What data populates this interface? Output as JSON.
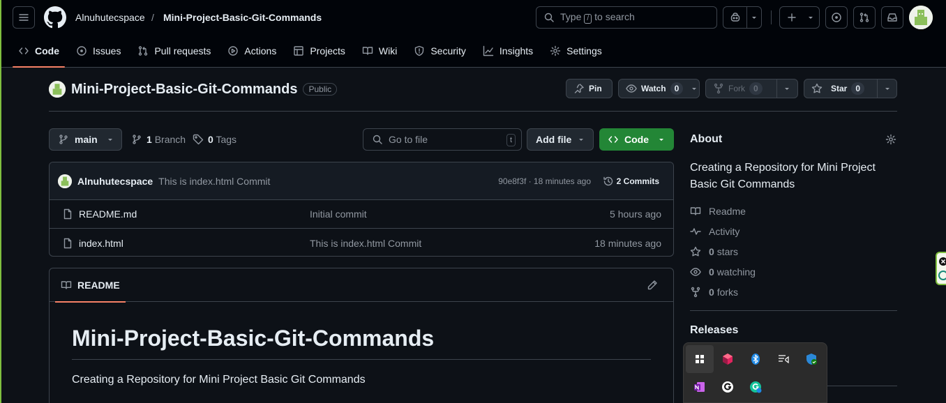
{
  "header": {
    "owner": "Alnuhutecspace",
    "separator": "/",
    "repo": "Mini-Project-Basic-Git-Commands",
    "search_prefix": "Type",
    "search_key": "/",
    "search_suffix": "to search"
  },
  "tabs": [
    {
      "label": "Code",
      "icon": "code-icon",
      "active": true
    },
    {
      "label": "Issues",
      "icon": "issue-icon"
    },
    {
      "label": "Pull requests",
      "icon": "pull-request-icon"
    },
    {
      "label": "Actions",
      "icon": "play-icon"
    },
    {
      "label": "Projects",
      "icon": "table-icon"
    },
    {
      "label": "Wiki",
      "icon": "book-icon"
    },
    {
      "label": "Security",
      "icon": "shield-icon"
    },
    {
      "label": "Insights",
      "icon": "graph-icon"
    },
    {
      "label": "Settings",
      "icon": "gear-icon"
    }
  ],
  "repo_head": {
    "name": "Mini-Project-Basic-Git-Commands",
    "visibility": "Public",
    "pin_label": "Pin",
    "watch_label": "Watch",
    "watch_count": "0",
    "fork_label": "Fork",
    "fork_count": "0",
    "star_label": "Star",
    "star_count": "0"
  },
  "toolbar": {
    "branch": "main",
    "branch_count": "1",
    "branch_label": "Branch",
    "tag_count": "0",
    "tag_label": "Tags",
    "goto_placeholder": "Go to file",
    "goto_key": "t",
    "add_file_label": "Add file",
    "code_label": "Code"
  },
  "commit": {
    "author": "Alnuhutecspace",
    "message": "This is index.html Commit",
    "sha_time": "90e8f3f · 18 minutes ago",
    "commits_label": "2 Commits"
  },
  "files": [
    {
      "name": "README.md",
      "message": "Initial commit",
      "time": "5 hours ago"
    },
    {
      "name": "index.html",
      "message": "This is index.html Commit",
      "time": "18 minutes ago"
    }
  ],
  "readme": {
    "tab_label": "README",
    "heading": "Mini-Project-Basic-Git-Commands",
    "body": "Creating a Repository for Mini Project Basic Git Commands"
  },
  "about": {
    "title": "About",
    "description": "Creating a Repository for Mini Project Basic Git Commands",
    "readme": "Readme",
    "activity": "Activity",
    "stars_count": "0",
    "stars_label": "stars",
    "watching_count": "0",
    "watching_label": "watching",
    "forks_count": "0",
    "forks_label": "forks",
    "releases_title": "Releases"
  },
  "tray_icons": [
    "widgets-icon",
    "app-icon-red",
    "bluetooth-icon",
    "media-icon",
    "defender-icon",
    "onenote-icon",
    "grammarly-icon",
    "grammarly-edge-icon"
  ],
  "colors": {
    "accent_green": "#238636",
    "tab_underline": "#f78166",
    "background": "#0d1117",
    "header_bg": "#010409"
  }
}
